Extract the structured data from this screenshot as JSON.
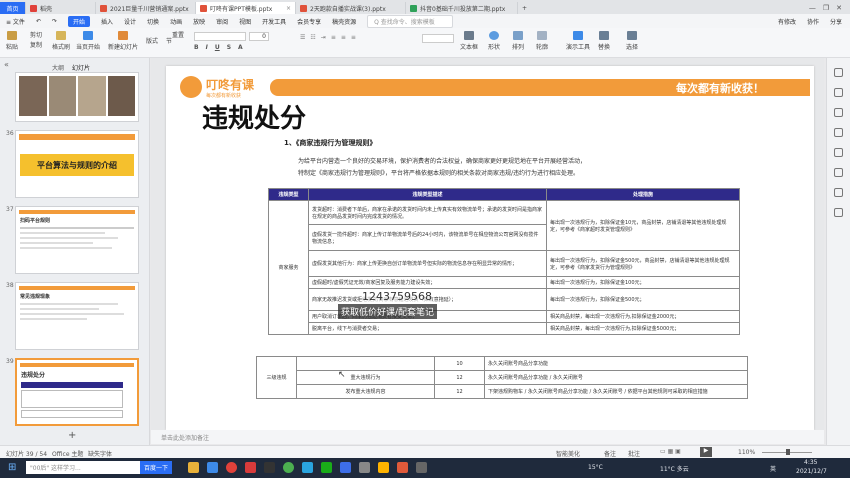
{
  "titlebar": {
    "tabs": [
      {
        "label": "首页",
        "color": "#2a6df4"
      },
      {
        "label": "稻壳",
        "color": "#e0413a"
      },
      {
        "label": "2021巨量千川营销通案.pptx",
        "color": "#e0523a"
      },
      {
        "label": "叮咚有课PPT模板.pptx",
        "color": "#e0523a"
      },
      {
        "label": "2天跑款自播实战课(3).pptx",
        "color": "#e0523a"
      },
      {
        "label": "抖音0基础千川投放第二期.pptx",
        "color": "#2fa15a"
      }
    ],
    "new_tab": "+",
    "right": {
      "login": "登录",
      "collab": "协作",
      "share": "分享"
    }
  },
  "menubar": {
    "file": "≡ 文件",
    "start": "开始",
    "items": [
      "插入",
      "设计",
      "切换",
      "动画",
      "放映",
      "审阅",
      "视图",
      "开发工具",
      "会员专享",
      "稿壳资源"
    ],
    "search_placeholder": "Q 查找命令、搜索模板",
    "right": [
      "有修改",
      "协作",
      "分享"
    ]
  },
  "toolbar": {
    "paste": "粘贴",
    "cut": "剪切",
    "copy": "复制",
    "format": "格式刷",
    "from_start": "当页开始",
    "new_slide": "新建幻灯片",
    "layout": "版式",
    "section": "节",
    "reset": "重置",
    "font_size": "0",
    "textbox": "文本框",
    "shape": "形状",
    "arrange": "排列",
    "outline": "轮廓",
    "show_tool": "演示工具",
    "replace": "替换",
    "select": "选择"
  },
  "leftpanel": {
    "tabs": [
      "大纲",
      "幻灯片"
    ],
    "slides": [
      {
        "num": "",
        "title": ""
      },
      {
        "num": "36",
        "title": "平台算法与规则的介绍"
      },
      {
        "num": "37",
        "title": "扫码平台规则"
      },
      {
        "num": "38",
        "title": "常见违规现象"
      },
      {
        "num": "39",
        "title": "违规处分"
      }
    ],
    "add": "+"
  },
  "slide": {
    "logo_name": "叮咚有课",
    "logo_sub": "每次都有新收获",
    "banner": "每次都有新收获！",
    "title": "违规处分",
    "section": "1、《商家违规行为管理规则》",
    "para1": "为给平台内营造一个良好的交易环境，保护消费者的合法权益，确保商家更好更规范地在平台开展经营活动，",
    "para2": "特制定《商家违规行为管理规则》，平台将严格依据本规则的相关条款对商家违规/违约行为进行相应处理。",
    "table_headers": [
      "违规类型",
      "违规类型描述",
      "处理措施"
    ],
    "table_category": "商家服务",
    "table_rows": [
      {
        "desc": "发货超时：消费者下单后，商家在承诺的发货时间内未上传真实有效物流单号；承诺的发货时间是指商家在规定的商品发货时间内完成发货的情况。",
        "measure": "每出现一次违规行为，扣除保证金10元，商品封禁，店铺清退等其他违规处理规定，可参考《商家超时发货管理规则》"
      },
      {
        "desc": "虚假发货一揽件超时：商家上传订单物流单号后的24小时内，该物流单号在相应物流公司官网没有揽件物流信息；",
        "measure": ""
      },
      {
        "desc": "虚假发货其他行为：商家上传更换自创订单物流单号但实际的物流信息存在明显异常的情形；",
        "measure": "每出现一次违规行为，扣除保证金500元，商品封禁，店铺清退等其他违规处理规定，可参考《商家发货行为管理规则》"
      },
      {
        "desc": "虚假超时/虚假凭证无效/商家回复及服务能力建设失效；",
        "measure": "每出现一次违规行为，扣除保证金100元；"
      },
      {
        "desc": "商家无故推迟发货或拒绝发货/商家有意延迟发货（如故意拖延）；",
        "measure": "每出现一次违规行为，扣除保证金500元；"
      },
      {
        "desc": "用户取消订单后，商家仍强迫消费者接受交易；",
        "measure": "相关商品封禁，每出现一次违规行为,扣除保证金2000元；"
      },
      {
        "desc": "脱离平台，线下与消费者交易；",
        "measure": "相关商品封禁，每出现一次违规行为,扣除保证金5000元；"
      }
    ],
    "table2": {
      "category": "三级违规",
      "rows": [
        {
          "type": "",
          "score": "10",
          "measure": "永久关闭账号商品分享功能"
        },
        {
          "type": "重大违规行为",
          "score": "12",
          "measure": "永久关闭账号商品分享功能 / 永久关闭账号"
        },
        {
          "type": "发布重大违规内容",
          "score": "12",
          "measure": "下架违规购物车 / 永久关闭账号商品分享功能 / 永久关闭账号 / 依据平台其他规则可采取的相应措施"
        }
      ]
    },
    "watermark_phone": "1243759568",
    "watermark_text": "获取低价好课/配套笔记"
  },
  "notes": {
    "placeholder": "单击此处添加备注"
  },
  "statusbar": {
    "slide_info": "幻灯片 39 / 54",
    "theme": "Office 主题",
    "font": "缺失字体",
    "smart": "智能美化",
    "notes": "备注",
    "comments": "批注",
    "zoom": "110%"
  },
  "taskbar": {
    "search_placeholder": "\"00后\" 这样学习...",
    "search_button": "百度一下",
    "weather1": "15°C",
    "weather2": "11°C 多云",
    "time": "4:35",
    "date": "2021/12/7",
    "ime": "英"
  }
}
